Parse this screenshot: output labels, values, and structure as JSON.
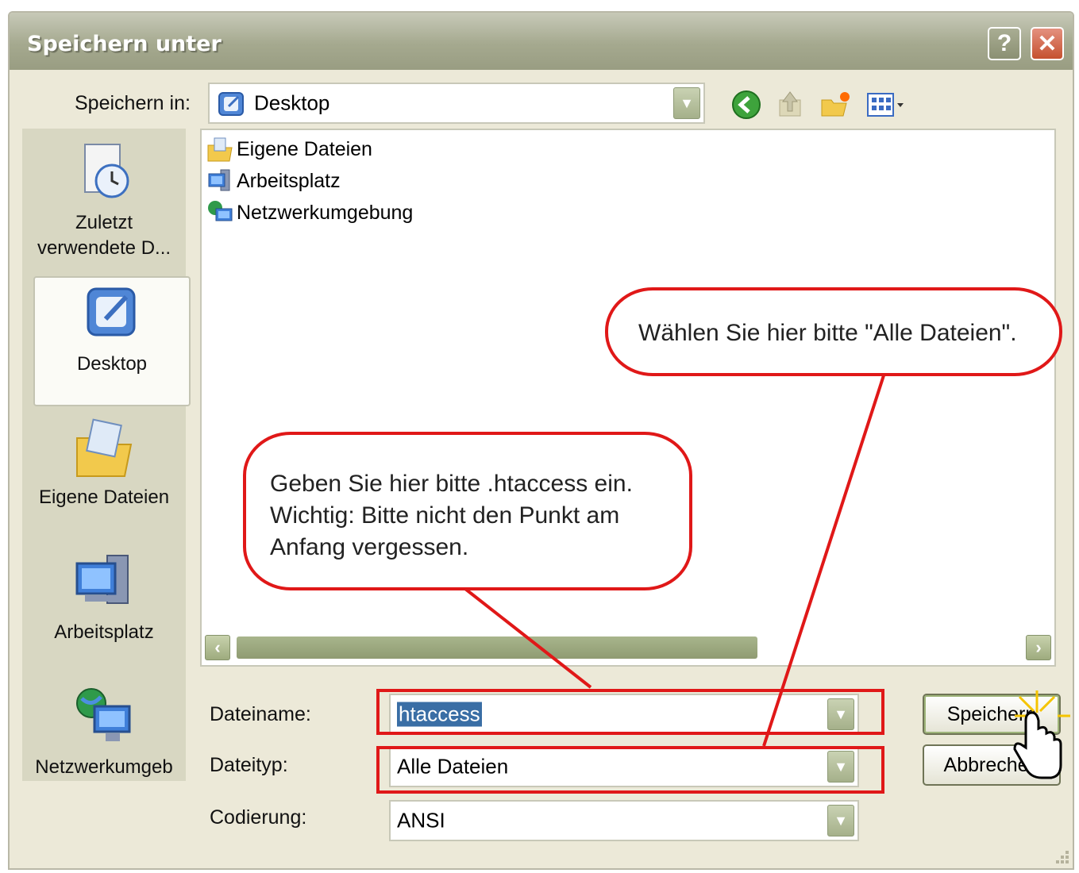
{
  "window": {
    "title": "Speichern unter"
  },
  "titlebar": {
    "help_label": "?",
    "close_label": "✕"
  },
  "toolbar": {
    "save_in_label": "Speichern in:",
    "location_value": "Desktop"
  },
  "places": [
    {
      "label_line1": "Zuletzt",
      "label_line2": "verwendete D...",
      "icon": "recent-documents-icon"
    },
    {
      "label_line1": "Desktop",
      "icon": "desktop-icon",
      "selected": true
    },
    {
      "label_line1": "Eigene Dateien",
      "icon": "my-documents-icon"
    },
    {
      "label_line1": "Arbeitsplatz",
      "icon": "my-computer-icon"
    },
    {
      "label_line1": "Netzwerkumgeb",
      "icon": "network-places-icon"
    }
  ],
  "files": [
    {
      "name": "Eigene Dateien",
      "icon": "my-documents-icon"
    },
    {
      "name": "Arbeitsplatz",
      "icon": "my-computer-icon"
    },
    {
      "name": "Netzwerkumgebung",
      "icon": "network-places-icon"
    }
  ],
  "form": {
    "filename_label": "Dateiname:",
    "filename_value": "htaccess",
    "filetype_label": "Dateityp:",
    "filetype_value": "Alle Dateien",
    "encoding_label": "Codierung:",
    "encoding_value": "ANSI"
  },
  "buttons": {
    "save_label": "Speichern",
    "cancel_label": "Abbrechen"
  },
  "annotations": {
    "filetype_hint": "Wählen Sie hier bitte \"Alle Dateien\".",
    "filename_hint_line1": "Geben Sie hier bitte .htaccess ein.",
    "filename_hint_line2": "Wichtig: Bitte nicht den Punkt am",
    "filename_hint_line3": "Anfang vergessen."
  },
  "colors": {
    "annotation_red": "#e01818",
    "dialog_bg": "#ece9d8"
  }
}
